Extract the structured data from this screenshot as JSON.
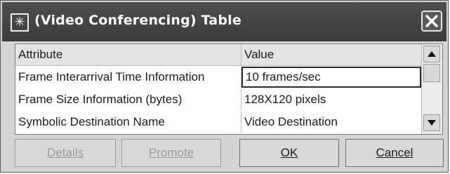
{
  "window": {
    "title": "(Video Conferencing) Table"
  },
  "table": {
    "headers": {
      "attribute": "Attribute",
      "value": "Value"
    },
    "rows": [
      {
        "attribute": "Frame Interarrival Time Information",
        "value": "10 frames/sec"
      },
      {
        "attribute": "Frame Size Information (bytes)",
        "value": "128X120 pixels"
      },
      {
        "attribute": "Symbolic Destination Name",
        "value": "Video Destination"
      }
    ]
  },
  "buttons": {
    "details": "Details",
    "promote": "Promote",
    "ok": "OK",
    "cancel": "Cancel"
  },
  "icons": {
    "app": "asterisk-icon",
    "close": "close-icon",
    "scroll_up": "arrow-up-icon",
    "scroll_down": "arrow-down-icon"
  }
}
